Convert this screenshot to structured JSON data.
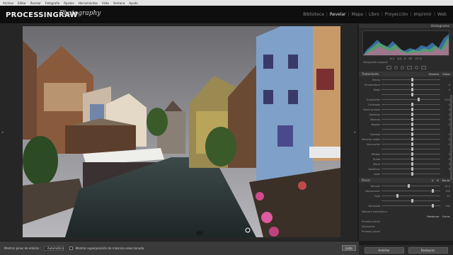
{
  "menubar": [
    "Archivo",
    "Editar",
    "Revelar",
    "Fotografía",
    "Ajustes",
    "Herramientas",
    "Vista",
    "Ventana",
    "Ayuda"
  ],
  "identity": {
    "brand": "PROCESSINGRAW",
    "script": "Photography"
  },
  "modules": [
    {
      "label": "Biblioteca",
      "active": false
    },
    {
      "label": "Revelar",
      "active": true
    },
    {
      "label": "Mapa",
      "active": false
    },
    {
      "label": "Libro",
      "active": false
    },
    {
      "label": "Proyección",
      "active": false
    },
    {
      "label": "Imprimir",
      "active": false
    },
    {
      "label": "Web",
      "active": false
    }
  ],
  "right_panel": {
    "histogram_title": "Histograma",
    "histo_values": [
      "5.2",
      "1/4",
      "5",
      "f/7",
      "27 %"
    ],
    "original": "Fotografía original",
    "basic": {
      "left": "Tratamiento",
      "a": "Muestra",
      "b": "Editar"
    },
    "section2": {
      "title": "Pincel",
      "a": "A",
      "b": "B",
      "c": "Borrar"
    },
    "brush_rows": [
      {
        "label": "Tamaño",
        "value": "14,0",
        "pos": 0.45
      },
      {
        "label": "Desvanecer",
        "value": "100",
        "pos": 0.85
      },
      {
        "label": "Flujo",
        "value": "25",
        "pos": 0.25
      },
      {
        "label": "",
        "value": "",
        "pos": 0.5
      },
      {
        "label": "Densidad",
        "value": "100",
        "pos": 0.85
      }
    ],
    "brush_opts": [
      "Máscara automática"
    ],
    "sliders": [
      {
        "label": "Efecto",
        "value": "",
        "pos": 0.5
      },
      {
        "label": "Temperatura",
        "value": "0",
        "pos": 0.5
      },
      {
        "label": "Matiz",
        "value": "0",
        "pos": 0.5
      },
      {
        "label": "",
        "value": "",
        "pos": 0.5
      },
      {
        "label": "Exposición",
        "value": "0,64",
        "pos": 0.62
      },
      {
        "label": "Contraste",
        "value": "0",
        "pos": 0.5
      },
      {
        "label": "Iluminaciones",
        "value": "0",
        "pos": 0.5
      },
      {
        "label": "Sombras",
        "value": "0",
        "pos": 0.5
      },
      {
        "label": "Blancos",
        "value": "0",
        "pos": 0.5
      },
      {
        "label": "Negros",
        "value": "0",
        "pos": 0.5
      },
      {
        "label": "",
        "value": "",
        "pos": 0.5
      },
      {
        "label": "Claridad",
        "value": "0",
        "pos": 0.5
      },
      {
        "label": "Eliminar neblina",
        "value": "0",
        "pos": 0.5
      },
      {
        "label": "Saturación",
        "value": "0",
        "pos": 0.5
      },
      {
        "label": "",
        "value": "",
        "pos": 0.5
      },
      {
        "label": "Nitidez",
        "value": "0",
        "pos": 0.5
      },
      {
        "label": "Ruido",
        "value": "0",
        "pos": 0.5
      },
      {
        "label": "Moiré",
        "value": "0",
        "pos": 0.5
      },
      {
        "label": "Desflecar",
        "value": "0",
        "pos": 0.5
      },
      {
        "label": "Color",
        "value": "",
        "pos": 0.5
      }
    ],
    "reset_labels": [
      "Restaurar",
      "Cerrar"
    ],
    "lower": {
      "a": "Primario pincel",
      "b": "Saturación",
      "c": "Primario pincel"
    },
    "footer": [
      "Anterior",
      "Restaurar"
    ]
  },
  "toolbar": {
    "label": "Mostrar pines de edición :",
    "select": "Automático",
    "checkbox_label": "Mostrar superposición de máscara seleccionada",
    "done": "Listo"
  },
  "colors": {
    "accent": "#e8e8e8",
    "bg": "#1c1c1c",
    "panel": "#2b2b2b"
  },
  "icons": [
    "crop-icon",
    "spot-removal-icon",
    "red-eye-icon",
    "graduated-filter-icon",
    "radial-filter-icon",
    "adjustment-brush-icon"
  ]
}
